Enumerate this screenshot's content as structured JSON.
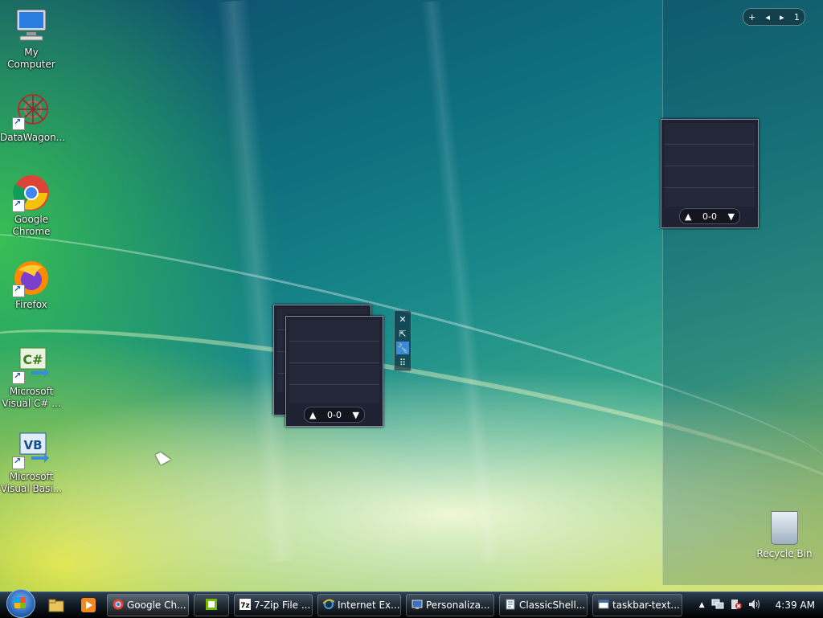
{
  "desktop": {
    "icons": [
      {
        "label": "My Computer"
      },
      {
        "label": "DataWagon..."
      },
      {
        "label": "Google Chrome"
      },
      {
        "label": "Firefox"
      },
      {
        "label": "Microsoft Visual C# ..."
      },
      {
        "label": "Microsoft Visual Basi..."
      }
    ],
    "recycle_bin": {
      "label": "Recycle Bin"
    }
  },
  "sidebar": {
    "control": {
      "add": "+",
      "prev": "◂",
      "next": "▸",
      "page": "1"
    }
  },
  "gadgets": [
    {
      "pager": "0-0"
    },
    {
      "pager": "0-0"
    }
  ],
  "gadget_tools": {
    "close": "✕",
    "popout": "⇱",
    "settings": "🔧",
    "drag": "⠿"
  },
  "taskbar": {
    "tasks": [
      {
        "label": "Google Ch...",
        "icon": "chrome-icon"
      },
      {
        "label": "",
        "icon": "nvidia-icon"
      },
      {
        "label": "7-Zip File ...",
        "icon": "7zip-icon"
      },
      {
        "label": "Internet Ex...",
        "icon": "ie-icon"
      },
      {
        "label": "Personaliza...",
        "icon": "personalization-icon"
      },
      {
        "label": "ClassicShell...",
        "icon": "classicshell-icon"
      },
      {
        "label": "taskbar-text...",
        "icon": "notepad-icon"
      }
    ],
    "clock": "4:39 AM"
  },
  "colors": {
    "taskbar": "#101a24",
    "accent": "#3a8cd9",
    "gadget": "#1f2233"
  }
}
